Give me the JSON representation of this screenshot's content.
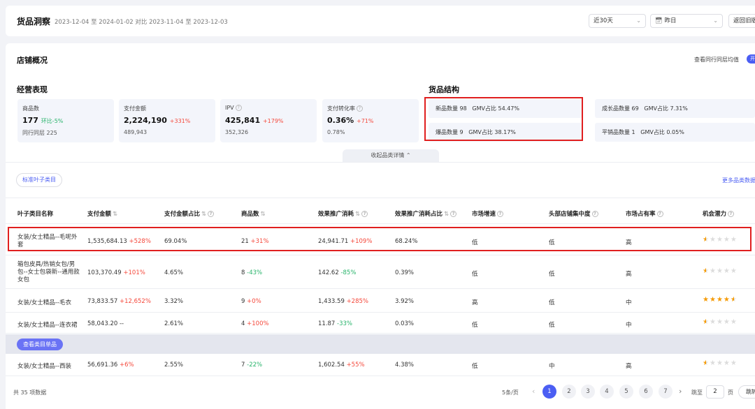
{
  "header": {
    "title": "货品洞察",
    "date_range": "2023-12-04 至 2024-01-02 对比 2023-11-04 至 2023-12-03",
    "period_select": "近30天",
    "date_select": "昨日",
    "back_button": "返回旧版"
  },
  "overview": {
    "title": "店铺概况",
    "peer_avg_label": "查看同行同层均值",
    "toggle_label": "开",
    "perf_title": "经营表现",
    "structure_title": "货品结构",
    "collapse_label": "收起品类详情"
  },
  "metrics": [
    {
      "label": "商品数",
      "value": "177",
      "delta": "环比-5%",
      "sub": "同行同层 225",
      "help": false
    },
    {
      "label": "支付金额",
      "value": "2,224,190",
      "delta": "+331%",
      "sub": "489,943",
      "help": false
    },
    {
      "label": "IPV",
      "value": "425,841",
      "delta": "+179%",
      "sub": "352,326",
      "help": true
    },
    {
      "label": "支付转化率",
      "value": "0.36%",
      "delta": "+71%",
      "sub": "0.78%",
      "help": true
    }
  ],
  "structure": [
    {
      "name": "新品数量",
      "count": "98",
      "gmv": "GMV占比 54.47%"
    },
    {
      "name": "爆品数量",
      "count": "9",
      "gmv": "GMV占比 38.17%"
    },
    {
      "name": "成长品数量",
      "count": "69",
      "gmv": "GMV占比 7.31%"
    },
    {
      "name": "平销品数量",
      "count": "1",
      "gmv": "GMV占比 0.05%"
    }
  ],
  "filter": {
    "chip": "标准叶子类目",
    "more_link": "更多品类数据"
  },
  "columns": [
    "叶子类目名称",
    "支付金额",
    "支付金额占比",
    "商品数",
    "效果推广消耗",
    "效果推广消耗占比",
    "市场增速",
    "头部店铺集中度",
    "市场占有率",
    "机会潜力"
  ],
  "rows": [
    {
      "name": "女装/女士精品--毛呢外套",
      "pay": "1,535,684.13",
      "pay_delta": "+528%",
      "share": "69.04%",
      "goods": "21",
      "goods_delta": "+31%",
      "ad": "24,941.71",
      "ad_delta": "+109%",
      "ad_share": "68.24%",
      "growth": "低",
      "conc": "低",
      "market": "高",
      "stars": 0.5
    },
    {
      "name": "箱包皮具/热销女包/男包--女士包袋新--通用款女包",
      "pay": "103,370.49",
      "pay_delta": "+101%",
      "share": "4.65%",
      "goods": "8",
      "goods_delta": "-43%",
      "ad": "142.62",
      "ad_delta": "-85%",
      "ad_share": "0.39%",
      "growth": "低",
      "conc": "低",
      "market": "高",
      "stars": 0.5
    },
    {
      "name": "女装/女士精品--毛衣",
      "pay": "73,833.57",
      "pay_delta": "+12,652%",
      "share": "3.32%",
      "goods": "9",
      "goods_delta": "+0%",
      "ad": "1,433.59",
      "ad_delta": "+285%",
      "ad_share": "3.92%",
      "growth": "高",
      "conc": "低",
      "market": "中",
      "stars": 4.5
    },
    {
      "name": "女装/女士精品--连衣裙",
      "pay": "58,043.20",
      "pay_delta": "--",
      "share": "2.61%",
      "goods": "4",
      "goods_delta": "+100%",
      "ad": "11.87",
      "ad_delta": "-33%",
      "ad_share": "0.03%",
      "growth": "低",
      "conc": "低",
      "market": "中",
      "stars": 0.5
    },
    {
      "name": "女装/女士精品--西装",
      "pay": "56,691.36",
      "pay_delta": "+6%",
      "share": "2.55%",
      "goods": "7",
      "goods_delta": "-22%",
      "ad": "1,602.54",
      "ad_delta": "+55%",
      "ad_share": "4.38%",
      "growth": "低",
      "conc": "中",
      "market": "高",
      "stars": 0.5
    }
  ],
  "view_items_button": "查看类目单品",
  "pagination": {
    "total": "共 35 项数据",
    "page_size": "5条/页",
    "prev": "‹",
    "next": "›",
    "pages": [
      "1",
      "2",
      "3",
      "4",
      "5",
      "6",
      "7"
    ],
    "current": "1",
    "jump_label": "跳至",
    "jump_value": "2",
    "page_unit": "页",
    "next_button": "跳转"
  }
}
